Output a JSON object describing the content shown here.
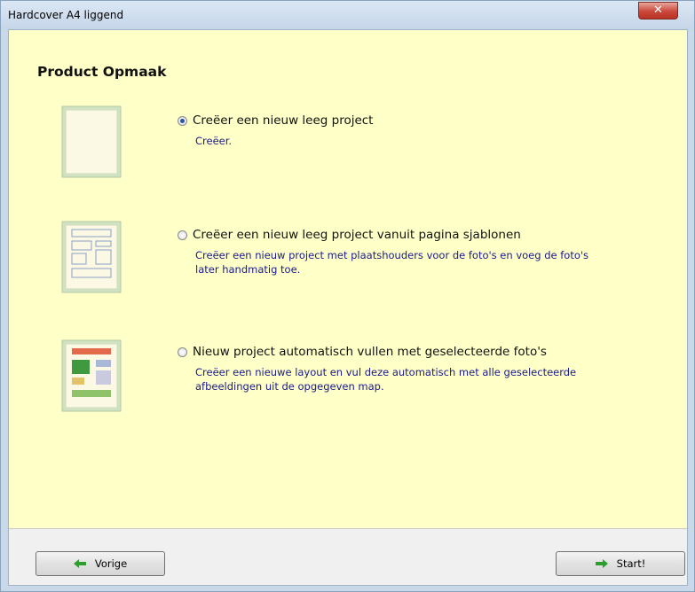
{
  "window": {
    "title": "Hardcover A4 liggend"
  },
  "heading": "Product Opmaak",
  "options": [
    {
      "title": "Creëer een nieuw leeg project",
      "description": "Creëer.",
      "selected": true
    },
    {
      "title": "Creëer een nieuw leeg project vanuit pagina sjablonen",
      "description": "Creëer een nieuw project met plaatshouders voor de foto's en voeg de foto's later handmatig toe.",
      "selected": false
    },
    {
      "title": "Nieuw project automatisch vullen met geselecteerde foto's",
      "description": "Creëer een nieuwe layout en vul deze automatisch met alle geselecteerde afbeeldingen uit de opgegeven map.",
      "selected": false
    }
  ],
  "buttons": {
    "back": "Vorige",
    "start": "Start!"
  },
  "icons": {
    "close": "close-icon",
    "back": "arrow-left-icon",
    "start": "arrow-right-icon"
  },
  "colors": {
    "content_bg": "#ffffc8",
    "description_text": "#1a1a8c",
    "arrow_green": "#2e9e2e"
  }
}
